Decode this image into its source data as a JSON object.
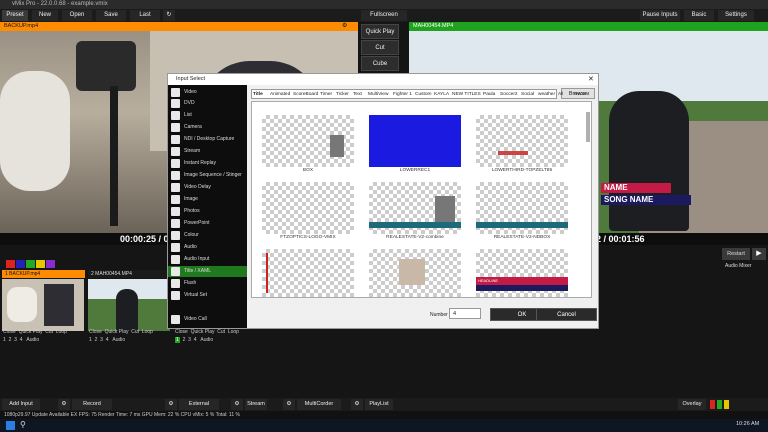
{
  "window": {
    "title": "vMix Pro - 22.0.0.68 - example.vmix"
  },
  "topbar": {
    "preset": "Preset",
    "new": "New",
    "open": "Open",
    "save": "Save",
    "last": "Last",
    "fullscreen": "Fullscreen",
    "pause_inputs": "Pause Inputs",
    "basic": "Basic",
    "settings": "Settings"
  },
  "preview": {
    "title": "BACKUP.mp4",
    "time": "00:00:25 / 0"
  },
  "output": {
    "title": "MAH00454.MP4",
    "time": "2 / 00:01:56",
    "restart": "Restart",
    "audio": "Audio Mixer",
    "lower_name": "NAME",
    "lower_song": "SONG NAME"
  },
  "transitions": {
    "quick_play": "Quick Play",
    "cut": "Cut",
    "cube": "Cube"
  },
  "inputs": [
    {
      "num": "1",
      "title": "BACKUP.mp4",
      "controls": [
        "Close",
        "Quick Play",
        "Cut",
        "Loop"
      ],
      "numbers": [
        "1",
        "2",
        "3",
        "4"
      ],
      "audio": "Audio"
    },
    {
      "num": "2",
      "title": "MAH00454.MP4",
      "controls": [
        "Close",
        "Quick Play",
        "Cut",
        "Loop"
      ],
      "numbers": [
        "1",
        "2",
        "3",
        "4"
      ],
      "audio": "Audio"
    },
    {
      "num": "3",
      "title": "",
      "controls": [
        "Close",
        "Quick Play",
        "Cut",
        "Loop"
      ],
      "numbers": [
        "1",
        "2",
        "3",
        "4"
      ],
      "audio": "Audio"
    }
  ],
  "dialog": {
    "title": "Input Select",
    "browse": "Browse",
    "sidebar": [
      "Video",
      "DVD",
      "List",
      "Camera",
      "NDI / Desktop Capture",
      "Stream",
      "Instant Replay",
      "Image Sequence / Stinger",
      "Video Delay",
      "Image",
      "Photos",
      "PowerPoint",
      "Colour",
      "Audio",
      "Audio Input",
      "Title / XAML",
      "Flash",
      "Virtual Set",
      "Video Call"
    ],
    "selected": "Title / XAML",
    "tabs": [
      "Title",
      "Animated",
      "ScoreBoard",
      "Timer",
      "Ticker",
      "Text",
      "MultiView",
      "Fighter 1",
      "Custom",
      "KAYLA",
      "NEW TITLES",
      "Paula",
      "Soccer2",
      "Social",
      "weather",
      "All",
      "Recent"
    ],
    "items": [
      "BOX",
      "LOWERREC1",
      "LOWERTHIRD-TOPZELT85",
      "FTZOPTICS-LOGO-VMIX",
      "REALESTATE-V2-combine",
      "REALESTATE-V2-NDBOX",
      "",
      "",
      "HEADLINE"
    ],
    "number_label": "Number",
    "number_value": "4",
    "ok": "OK",
    "cancel": "Cancel"
  },
  "bottombar": {
    "add_input": "Add Input",
    "record": "Record",
    "external": "External",
    "stream": "Stream",
    "multicorder": "MultiCorder",
    "playlist": "PlayList",
    "overlay": "Overlay"
  },
  "status": {
    "text": "1080p29.97  Update Available  EX  FPS: 75  Render Time: 7 ms  GPU Mem: 22 %  CPU vMix: 5 %  Total: 11 %"
  },
  "taskbar": {
    "time": "10:26 AM"
  },
  "colors": {
    "preview_bar": "#ff8c00",
    "output_bar": "#1fa31f",
    "accent_green": "#1f7a1f",
    "blue_item": "#1a1ae0"
  }
}
